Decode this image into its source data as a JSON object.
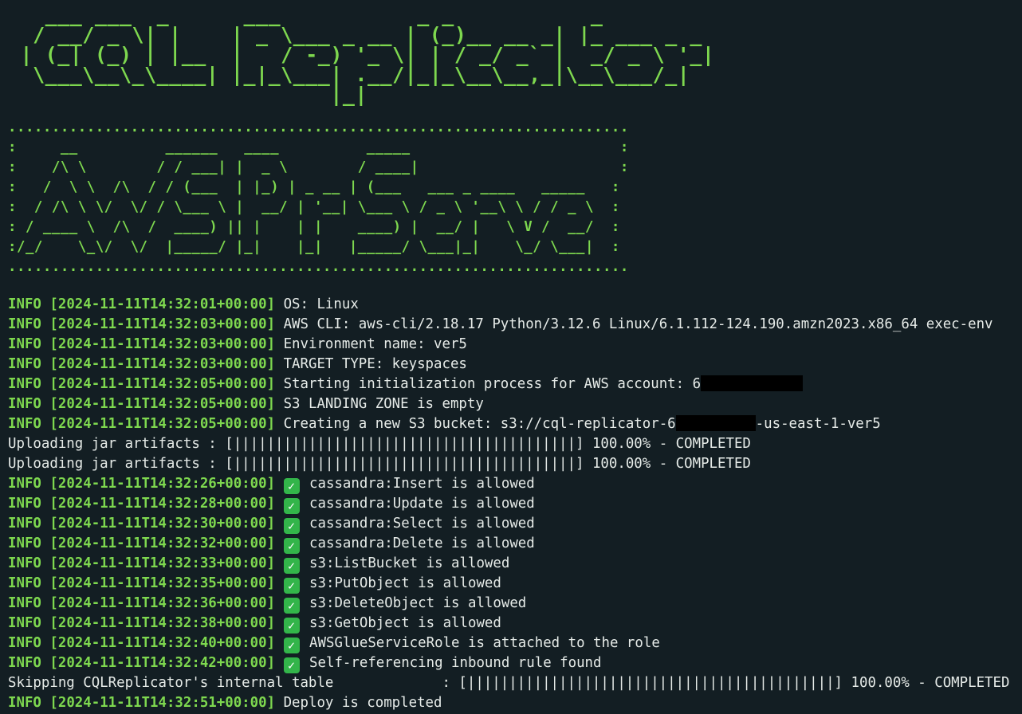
{
  "banner": {
    "title_art": "   ___ ___  _      ___           _ _           _\n  / __/ _ \\| |    | _ \\___ _ __ | (_)__ __ _| |_ ___ _ _\n | (_| (_) | |__  |   / -_) '_ \\| | / _/ _` |  _/ _ \\ '_|\n  \\___\\__\\_\\____| |_|_\\___| .__/|_|_\\__\\__,_|\\__\\___/_|\n                          |_|",
    "subtitle_art": ".......................................................................\n:     __          ______   ____          _____                        :\n:    /\\ \\        / / ___| |  _ \\        / ____|                       :\n:   /  \\ \\  /\\  / / (___  | |_) | _ __ | (___   ___ _ ____   _____   :\n:  / /\\ \\ \\/  \\/ / \\___ \\ |  __/ | '__| \\___ \\ / _ \\ '__\\ \\ / / _ \\  :\n: / ____ \\  /\\  /  ____) || |    | |    ____) |  __/ |   \\ V /  __/  :\n:/_/    \\_\\/  \\/  |_____/ |_|    |_|   |_____/ \\___|_|    \\_/ \\___|  :\n......................................................................."
  },
  "log": {
    "lines": [
      {
        "level": "INFO",
        "ts": "[2024-11-11T14:32:01+00:00]",
        "msg": "OS: Linux"
      },
      {
        "level": "INFO",
        "ts": "[2024-11-11T14:32:03+00:00]",
        "msg": "AWS CLI: aws-cli/2.18.17 Python/3.12.6 Linux/6.1.112-124.190.amzn2023.x86_64 exec-env"
      },
      {
        "level": "INFO",
        "ts": "[2024-11-11T14:32:03+00:00]",
        "msg": "Environment name: ver5"
      },
      {
        "level": "INFO",
        "ts": "[2024-11-11T14:32:03+00:00]",
        "msg": "TARGET TYPE: keyspaces"
      },
      {
        "level": "INFO",
        "ts": "[2024-11-11T14:32:05+00:00]",
        "msg": "Starting initialization process for AWS account: 6"
      },
      {
        "level": "INFO",
        "ts": "[2024-11-11T14:32:05+00:00]",
        "msg": "S3 LANDING ZONE is empty"
      },
      {
        "level": "INFO",
        "ts": "[2024-11-11T14:32:05+00:00]",
        "msg": "Creating a new S3 bucket: s3://cql-replicator-6",
        "msg_suffix": "-us-east-1-ver5"
      }
    ],
    "progress": [
      {
        "label": "Uploading jar artifacts : ",
        "bar": "[|||||||||||||||||||||||||||||||||||||||||]",
        "percent": "100.00%",
        "status": "- COMPLETED"
      },
      {
        "label": "Uploading jar artifacts : ",
        "bar": "[|||||||||||||||||||||||||||||||||||||||||]",
        "percent": "100.00%",
        "status": "- COMPLETED"
      }
    ],
    "checks": [
      {
        "level": "INFO",
        "ts": "[2024-11-11T14:32:26+00:00]",
        "msg": "cassandra:Insert is allowed"
      },
      {
        "level": "INFO",
        "ts": "[2024-11-11T14:32:28+00:00]",
        "msg": "cassandra:Update is allowed"
      },
      {
        "level": "INFO",
        "ts": "[2024-11-11T14:32:30+00:00]",
        "msg": "cassandra:Select is allowed"
      },
      {
        "level": "INFO",
        "ts": "[2024-11-11T14:32:32+00:00]",
        "msg": "cassandra:Delete is allowed"
      },
      {
        "level": "INFO",
        "ts": "[2024-11-11T14:32:33+00:00]",
        "msg": "s3:ListBucket is allowed"
      },
      {
        "level": "INFO",
        "ts": "[2024-11-11T14:32:35+00:00]",
        "msg": "s3:PutObject is allowed"
      },
      {
        "level": "INFO",
        "ts": "[2024-11-11T14:32:36+00:00]",
        "msg": "s3:DeleteObject is allowed"
      },
      {
        "level": "INFO",
        "ts": "[2024-11-11T14:32:38+00:00]",
        "msg": "s3:GetObject is allowed"
      },
      {
        "level": "INFO",
        "ts": "[2024-11-11T14:32:40+00:00]",
        "msg": "AWSGlueServiceRole is attached to the role"
      },
      {
        "level": "INFO",
        "ts": "[2024-11-11T14:32:42+00:00]",
        "msg": "Self-referencing inbound rule found"
      }
    ],
    "check_glyph": "✓",
    "table_progress": {
      "label": "Skipping CQLReplicator's internal table             : ",
      "bar": "[||||||||||||||||||||||||||||||||||||||||||||]",
      "percent": "100.00%",
      "status": "- COMPLETED"
    },
    "final": {
      "level": "INFO",
      "ts": "[2024-11-11T14:32:51+00:00]",
      "msg": "Deploy is completed"
    }
  },
  "colors": {
    "background": "#131e23",
    "accent_green": "#7ed84f",
    "text": "#e6ebe8",
    "check_green": "#33b54a",
    "redaction": "#000000"
  },
  "icons": {
    "check": "check-mark-icon"
  }
}
